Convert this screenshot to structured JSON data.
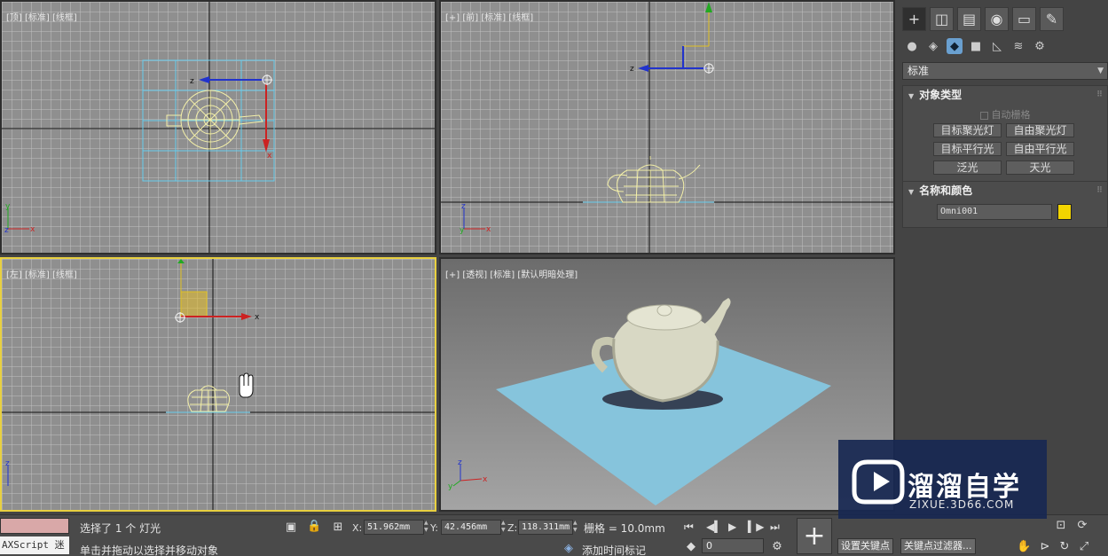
{
  "viewports": {
    "top": {
      "label": "[顶] [标准] [线框]"
    },
    "front": {
      "label": "[+] [前] [标准] [线框]"
    },
    "left": {
      "label": "[左] [标准] [线框]"
    },
    "perspective": {
      "label": "[+] [透视] [标准] [默认明暗处理]"
    }
  },
  "command_panel": {
    "tabs": [
      "create",
      "modify",
      "hierarchy",
      "motion",
      "display",
      "utilities"
    ],
    "category_dropdown": "标准",
    "object_type": {
      "title": "对象类型",
      "autogrid": "自动栅格",
      "buttons": [
        "目标聚光灯",
        "自由聚光灯",
        "目标平行光",
        "自由平行光",
        "泛光",
        "天光"
      ]
    },
    "name_color": {
      "title": "名称和颜色",
      "name": "Omni001",
      "color": "#f2d400"
    }
  },
  "status_bar": {
    "maxscript": "AXScript 迷",
    "selection": "选择了 1 个 灯光",
    "prompt": "单击并拖动以选择并移动对象",
    "x_label": "X:",
    "x": "51.962mm",
    "y_label": "Y:",
    "y": "42.456mm",
    "z_label": "Z:",
    "z": "118.311mm",
    "grid": "栅格 = 10.0mm",
    "add_time_tag": "添加时间标记",
    "frame": "0",
    "set_key": "设置关键点",
    "key_filters": "关键点过滤器..."
  },
  "watermark": {
    "title": "溜溜自学",
    "url": "ZIXUE.3D66.COM"
  }
}
